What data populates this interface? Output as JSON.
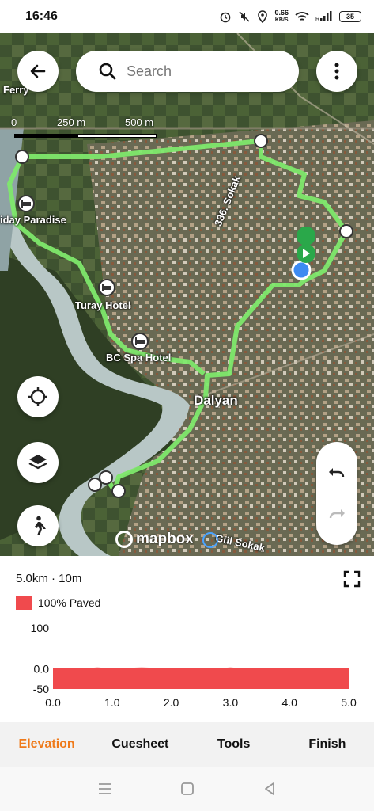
{
  "status": {
    "time": "16:46",
    "speed_value": "0.66",
    "speed_unit": "KB/S",
    "battery": "35"
  },
  "map": {
    "search_placeholder": "Search",
    "scale_labels": [
      "0",
      "250 m",
      "500 m"
    ],
    "labels": {
      "ferry": "Ferry",
      "holiday_paradise": "iday Paradise",
      "turay_hotel": "Turay Hotel",
      "bc_spa_hotel": "BC Spa Hotel",
      "dalyan": "Dalyan",
      "sokak_336": "336. Sokak",
      "gul_sokak": "Gül Sokak"
    },
    "attribution": "mapbox",
    "route_color": "#7ee86b"
  },
  "panel": {
    "distance_time": "5.0km · 10m",
    "legend_label": "100% Paved",
    "legend_color": "#f04a4d"
  },
  "chart_data": {
    "type": "area",
    "x": [
      0.0,
      0.25,
      0.5,
      0.75,
      1.0,
      1.25,
      1.5,
      1.75,
      2.0,
      2.25,
      2.5,
      2.75,
      3.0,
      3.25,
      3.5,
      3.75,
      4.0,
      4.25,
      4.5,
      4.75,
      5.0
    ],
    "series": [
      {
        "values": [
          1,
          2,
          1,
          3,
          1,
          2,
          3,
          2,
          1,
          2,
          2,
          1,
          3,
          1,
          2,
          1,
          1,
          2,
          1,
          2,
          2
        ]
      }
    ],
    "y_ticks": [
      "100",
      "0.0",
      "-50"
    ],
    "x_ticks": [
      "0.0",
      "1.0",
      "2.0",
      "3.0",
      "4.0",
      "5.0"
    ],
    "ylim": [
      -50,
      100
    ],
    "xlim": [
      0,
      5
    ],
    "color": "#f04a4d"
  },
  "tabs": [
    {
      "label": "Elevation",
      "active": true
    },
    {
      "label": "Cuesheet",
      "active": false
    },
    {
      "label": "Tools",
      "active": false
    },
    {
      "label": "Finish",
      "active": false
    }
  ]
}
